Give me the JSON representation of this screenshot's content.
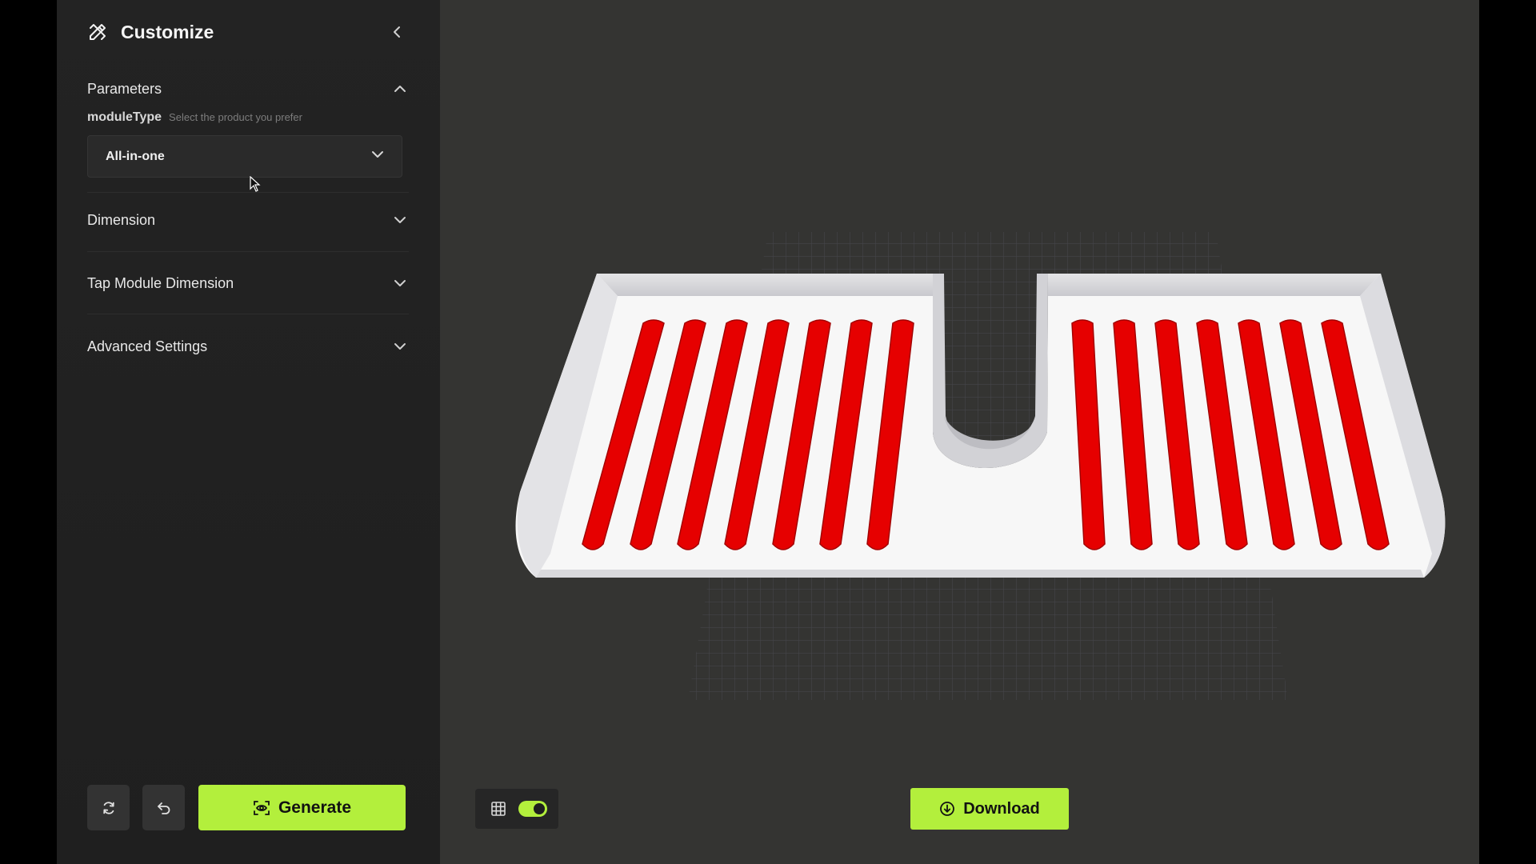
{
  "sidebar": {
    "title": "Customize",
    "logo_icon": "pencil-ruler-icon",
    "sections": {
      "parameters": {
        "label": "Parameters",
        "expanded": true
      },
      "dimension": {
        "label": "Dimension",
        "expanded": false
      },
      "tap_module": {
        "label": "Tap Module Dimension",
        "expanded": false
      },
      "advanced": {
        "label": "Advanced Settings",
        "expanded": false
      }
    },
    "module_type": {
      "name": "moduleType",
      "hint": "Select the product you prefer",
      "selected": "All-in-one"
    },
    "footer": {
      "reset_icon": "refresh-icon",
      "undo_icon": "undo-icon",
      "generate_label": "Generate"
    }
  },
  "viewport": {
    "grid_visible": true,
    "download_label": "Download"
  },
  "colors": {
    "accent": "#b3ef3c",
    "sidebar_bg": "#232323",
    "viewport_bg": "#343432",
    "model_white": "#f7f7f7",
    "model_red": "#e60000"
  }
}
